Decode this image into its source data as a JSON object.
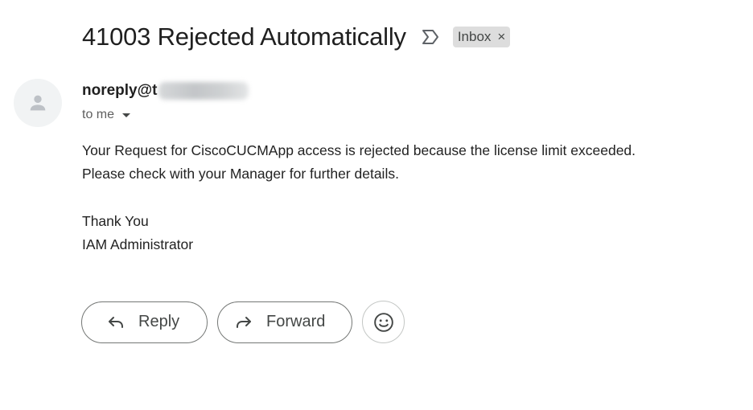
{
  "email": {
    "subject": "41003 Rejected Automatically",
    "label": "Inbox",
    "label_close": "×",
    "sender": "noreply@t",
    "recipient": "to me",
    "body_lines": [
      "Your Request for CiscoCUCMApp access is rejected because the license limit exceeded.",
      "Please check with your Manager for further details."
    ],
    "signoff_lines": [
      "Thank You",
      "IAM Administrator"
    ]
  },
  "actions": {
    "reply_label": "Reply",
    "forward_label": "Forward"
  },
  "icons": {
    "important": "important-marker-icon",
    "avatar": "person-icon",
    "reply": "reply-arrow-icon",
    "forward": "forward-arrow-icon",
    "emoji": "smiley-icon",
    "caret": "caret-down-icon"
  },
  "colors": {
    "chip_bg": "#dddddd",
    "text": "#222222",
    "muted": "#5e5e5e",
    "button_border": "#747775"
  }
}
